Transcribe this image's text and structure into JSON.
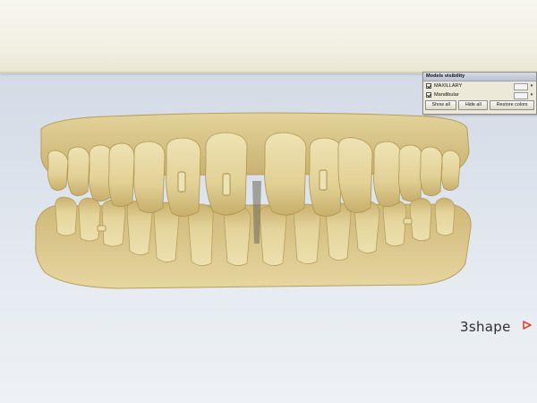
{
  "models_visibility": {
    "title": "Models visibility",
    "models": [
      {
        "label": "MAXILLARY",
        "checked": true,
        "color": "#f3f3f3"
      },
      {
        "label": "Mandibular",
        "checked": true,
        "color": "#f3f3f3"
      }
    ],
    "buttons": {
      "show_all": "Show all",
      "hide_all": "Hide all",
      "restore_colors": "Restore colors"
    },
    "dropdown_icon": "chevron-down-icon"
  },
  "branding": {
    "logo_text": "3shape",
    "logo_mark_color": "#e0452f"
  },
  "model": {
    "material_color": "#d9c488"
  }
}
